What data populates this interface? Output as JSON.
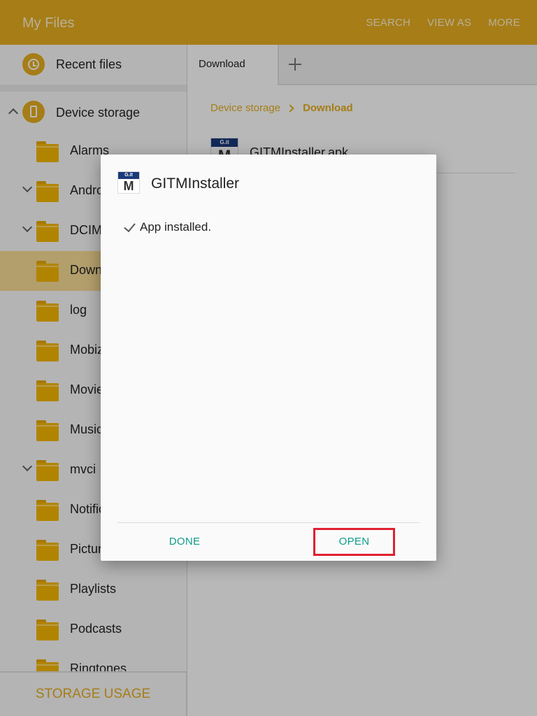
{
  "appbar": {
    "title": "My Files",
    "actions": [
      "SEARCH",
      "VIEW AS",
      "MORE"
    ]
  },
  "sidebar": {
    "recent_label": "Recent files",
    "recent_icon": "clock-icon",
    "device_label": "Device storage",
    "device_icon": "phone-icon",
    "folders": [
      {
        "label": "Alarms",
        "chevron": false,
        "selected": false
      },
      {
        "label": "Andro",
        "chevron": true,
        "selected": false
      },
      {
        "label": "DCIM",
        "chevron": true,
        "selected": false
      },
      {
        "label": "Down",
        "chevron": false,
        "selected": true
      },
      {
        "label": "log",
        "chevron": false,
        "selected": false
      },
      {
        "label": "Mobiz",
        "chevron": false,
        "selected": false
      },
      {
        "label": "Movie",
        "chevron": false,
        "selected": false
      },
      {
        "label": "Music",
        "chevron": false,
        "selected": false
      },
      {
        "label": "mvci",
        "chevron": true,
        "selected": false
      },
      {
        "label": "Notific",
        "chevron": false,
        "selected": false
      },
      {
        "label": "Pictur",
        "chevron": false,
        "selected": false
      },
      {
        "label": "Playlists",
        "chevron": false,
        "selected": false
      },
      {
        "label": "Podcasts",
        "chevron": false,
        "selected": false
      },
      {
        "label": "Ringtones",
        "chevron": false,
        "selected": false
      }
    ],
    "storage_button": "STORAGE USAGE"
  },
  "main": {
    "tab_label": "Download",
    "breadcrumb": [
      "Device storage",
      "Download"
    ],
    "file_name": "GITMInstaller.apk",
    "file_icon_band": "G.it",
    "file_icon_letter": "M"
  },
  "dialog": {
    "title": "GITMInstaller",
    "message": "App installed.",
    "done_label": "DONE",
    "open_label": "OPEN",
    "icon_band": "G.it",
    "icon_letter": "M"
  },
  "colors": {
    "accent": "#e6ad20",
    "selected_row": "#f8dd96",
    "button_text": "#0f9c8a",
    "highlight_box": "#e02030"
  }
}
